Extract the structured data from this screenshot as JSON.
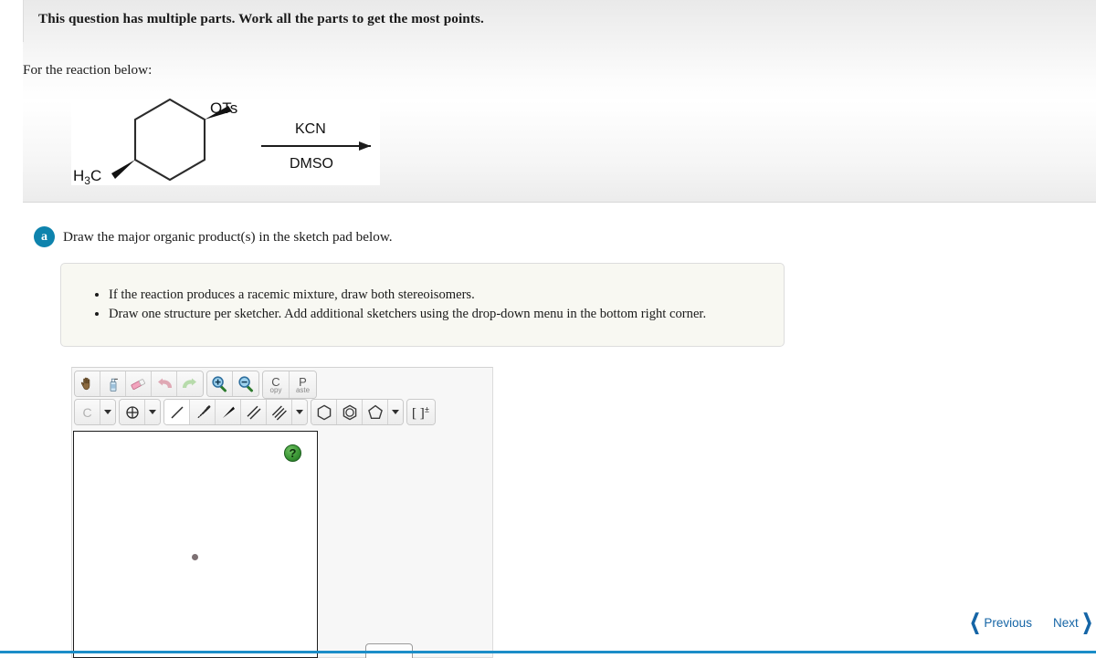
{
  "header": {
    "multipart_note": "This question has multiple parts. Work all the parts to get the most points."
  },
  "prompt": {
    "intro": "For the reaction below:"
  },
  "reaction": {
    "substituent_top": "OTs",
    "substituent_left": "H3C",
    "reagent_above": "KCN",
    "reagent_below": "DMSO"
  },
  "part": {
    "badge": "a",
    "text": "Draw the major organic product(s) in the sketch pad below."
  },
  "callout": {
    "bullets": [
      "If the reaction produces a racemic mixture, draw both stereoisomers.",
      "Draw one structure per sketcher. Add additional sketchers using the drop-down menu in the bottom right corner."
    ]
  },
  "sketcher": {
    "toolbar_row1": [
      {
        "name": "pan-hand-icon",
        "label": ""
      },
      {
        "name": "clear-spray-icon",
        "label": ""
      },
      {
        "name": "eraser-icon",
        "label": ""
      },
      {
        "name": "undo-icon",
        "label": ""
      },
      {
        "name": "redo-icon",
        "label": ""
      },
      {
        "name": "zoom-in-icon",
        "label": ""
      },
      {
        "name": "zoom-out-icon",
        "label": ""
      }
    ],
    "copy_button": {
      "big": "C",
      "small": "opy"
    },
    "paste_button": {
      "big": "P",
      "small": "aste"
    },
    "element_button_label": "C",
    "charge_tool_label": "[ ]±",
    "help_badge_label": "?",
    "selected_bond_tool": "single-bond"
  },
  "nav": {
    "previous_label": "Previous",
    "next_label": "Next",
    "previous_chevron": "❮",
    "next_chevron": "❯"
  },
  "colors": {
    "accent_blue": "#0e83ad",
    "nav_blue": "#1565a6",
    "rule_blue": "#1b8dc8",
    "callout_bg": "#f8f8f2",
    "help_green": "#3e9a38"
  }
}
